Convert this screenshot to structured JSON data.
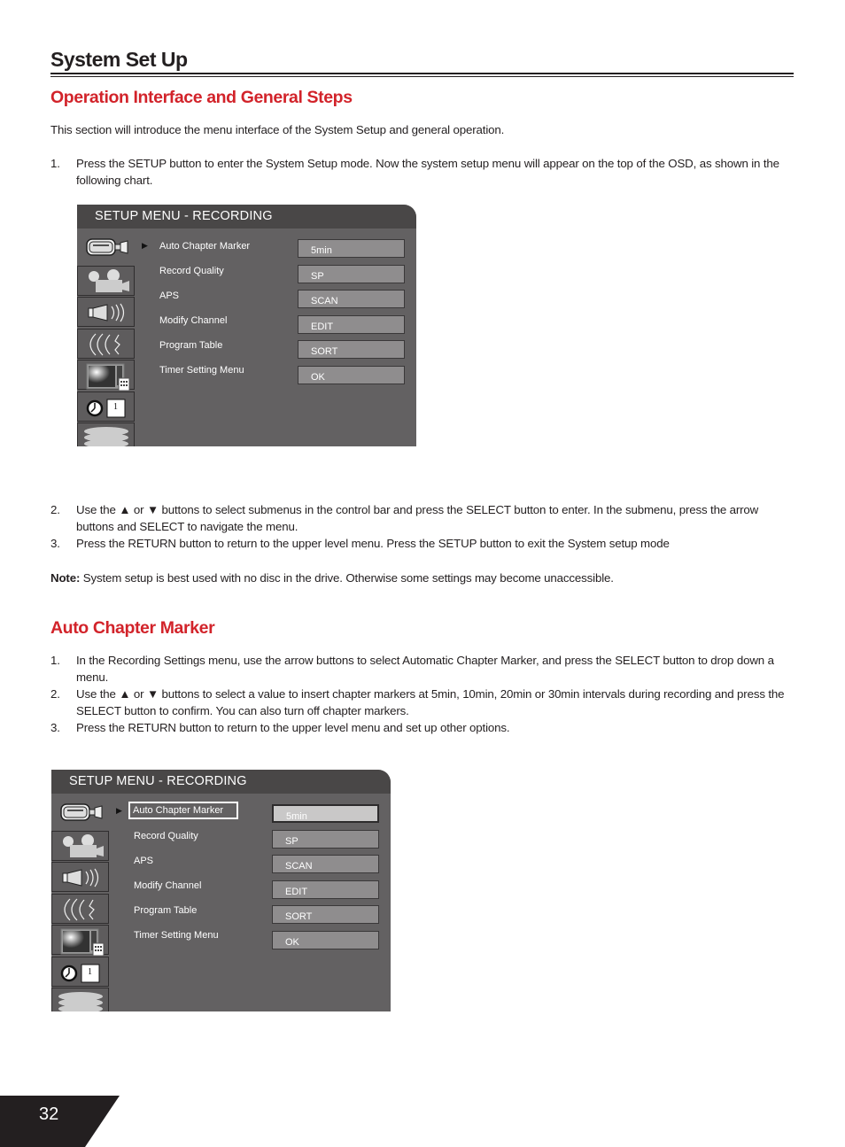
{
  "page": {
    "title": "System Set Up",
    "page_number": "32"
  },
  "section1": {
    "heading": "Operation Interface and General Steps",
    "intro": "This section will introduce the menu interface of the System Setup and general operation.",
    "steps": [
      {
        "num": "1.",
        "text": "Press the SETUP button to enter the System Setup mode. Now the system setup menu will appear on the top of the OSD, as shown in the following chart."
      },
      {
        "num": "2.",
        "text": "Use the ▲ or ▼  buttons to select submenus in the control bar and press the SELECT button to enter.  In the submenu, press the arrow buttons and SELECT to navigate the menu."
      },
      {
        "num": "3.",
        "text": "Press the RETURN button to return to the upper level menu. Press the SETUP button to exit the System setup mode"
      }
    ],
    "note_label": "Note:",
    "note_text": " System setup is best used with no disc in the drive. Otherwise some settings may become unaccessible."
  },
  "section2": {
    "heading": "Auto Chapter Marker",
    "steps": [
      {
        "num": "1.",
        "text": "In the Recording Settings menu, use the arrow buttons to select Automatic Chapter Marker, and press the SELECT button to drop down a menu."
      },
      {
        "num": "2.",
        "text": "Use the ▲ or ▼  buttons to select a value to insert chapter markers at 5min, 10min, 20min or 30min intervals during recording and press the SELECT button to confirm. You can also turn off chapter markers."
      },
      {
        "num": "3.",
        "text": "Press the RETURN button to return to the upper level menu and set up other options."
      }
    ]
  },
  "osd_menu": {
    "header": "SETUP MENU - RECORDING",
    "sidebar_icons": [
      "camcorder-icon",
      "film-camera-icon",
      "speaker-icon",
      "signal-waves-icon",
      "tv-icon",
      "clock-timer-icon",
      "disc-stack-icon"
    ],
    "timer_box_label": "1",
    "items": [
      {
        "label": "Auto Chapter Marker",
        "value": "5min"
      },
      {
        "label": "Record Quality",
        "value": "SP"
      },
      {
        "label": "APS",
        "value": "SCAN"
      },
      {
        "label": "Modify Channel",
        "value": "EDIT"
      },
      {
        "label": "Program Table",
        "value": "SORT"
      },
      {
        "label": "Timer Setting Menu",
        "value": "OK"
      }
    ]
  }
}
